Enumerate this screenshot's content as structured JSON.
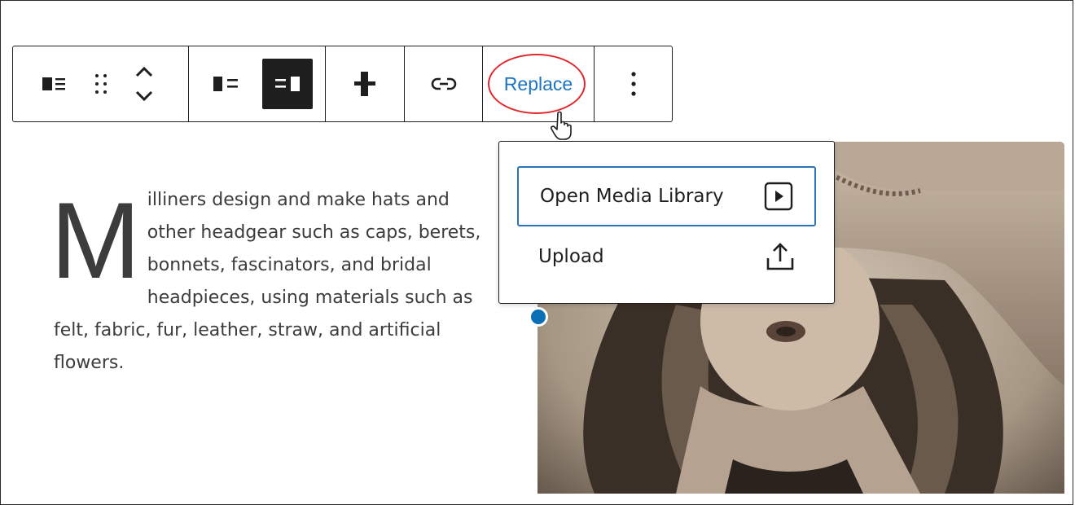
{
  "toolbar": {
    "buttons": [
      {
        "name": "block-type-media-text",
        "icon": "media-text-icon"
      },
      {
        "name": "drag-handle",
        "icon": "drag-icon"
      },
      {
        "name": "move-up-down",
        "icon": "chevron-up-down-icon"
      },
      {
        "name": "media-left",
        "icon": "media-left-icon"
      },
      {
        "name": "media-right",
        "icon": "media-right-icon",
        "active": true
      },
      {
        "name": "vertical-align",
        "icon": "vertical-align-icon"
      },
      {
        "name": "insert-link",
        "icon": "link-icon"
      },
      {
        "name": "options",
        "icon": "more-vertical-icon"
      }
    ],
    "replace_label": "Replace"
  },
  "content": {
    "dropcap": "M",
    "paragraph": "illiners design and make hats and other headgear such as caps, berets, bonnets, fascinators, and bridal headpieces, using materials such as felt, fabric, fur, leather, straw, and artificial flowers."
  },
  "dropdown": {
    "items": [
      {
        "label": "Open Media Library",
        "icon": "media-library-icon"
      },
      {
        "label": "Upload",
        "icon": "upload-icon"
      }
    ]
  },
  "colors": {
    "accent": "#1d74c4",
    "highlight_ring": "#e0262b",
    "handle": "#0a6fb5",
    "toolbar_active": "#1e1e1e"
  }
}
